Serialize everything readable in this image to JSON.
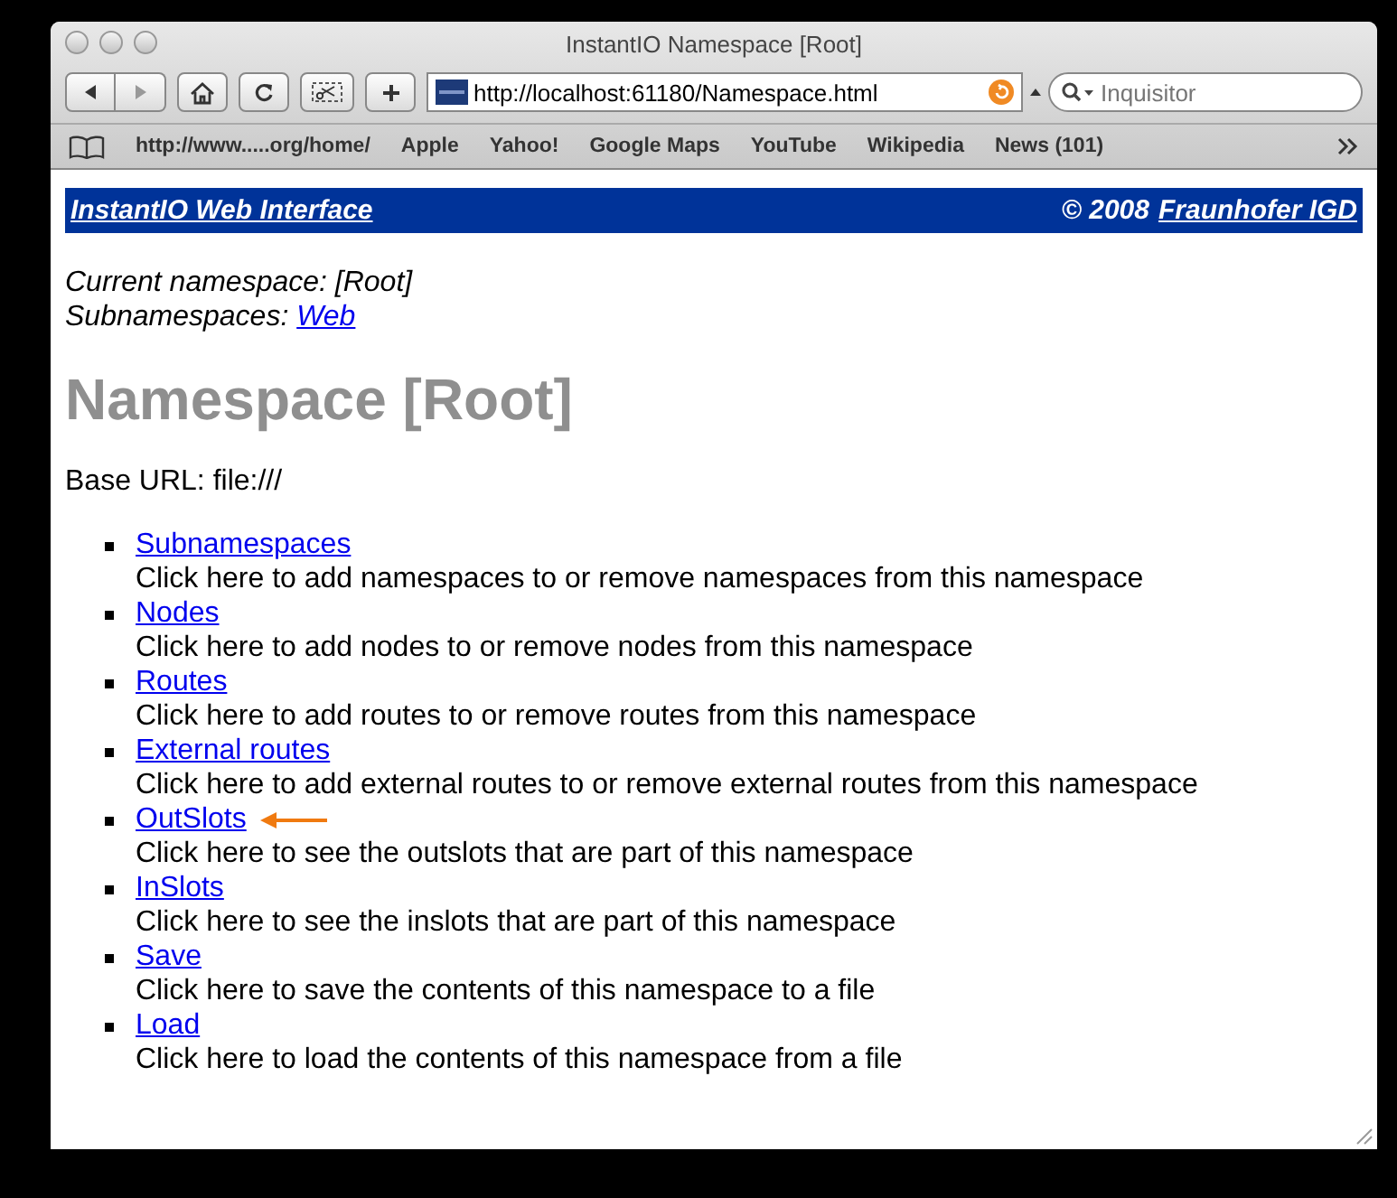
{
  "window": {
    "title": "InstantIO Namespace [Root]"
  },
  "toolbar": {
    "address": "http://localhost:61180/Namespace.html",
    "search_placeholder": "Inquisitor"
  },
  "bookmarks": [
    "http://www.....org/home/",
    "Apple",
    "Yahoo!",
    "Google Maps",
    "YouTube",
    "Wikipedia",
    "News (101)"
  ],
  "banner": {
    "title": "InstantIO Web Interface",
    "copyright": "© 2008",
    "owner": "Fraunhofer IGD"
  },
  "current": {
    "label": "Current namespace:",
    "value": "[Root]"
  },
  "subnamespaces": {
    "label": "Subnamespaces:",
    "link": "Web"
  },
  "heading": "Namespace [Root]",
  "base_url": "Base URL: file:///",
  "items": [
    {
      "link": "Subnamespaces",
      "description": "Click here to add namespaces to or remove namespaces from this namespace",
      "marked": false
    },
    {
      "link": "Nodes",
      "description": "Click here to add nodes to or remove nodes from this namespace",
      "marked": false
    },
    {
      "link": "Routes",
      "description": "Click here to add routes to or remove routes from this namespace",
      "marked": false
    },
    {
      "link": "External routes",
      "description": "Click here to add external routes to or remove external routes from this namespace",
      "marked": false
    },
    {
      "link": "OutSlots",
      "description": "Click here to see the outslots that are part of this namespace",
      "marked": true
    },
    {
      "link": "InSlots",
      "description": "Click here to see the inslots that are part of this namespace",
      "marked": false
    },
    {
      "link": "Save",
      "description": "Click here to save the contents of this namespace to a file",
      "marked": false
    },
    {
      "link": "Load",
      "description": "Click here to load the contents of this namespace from a file",
      "marked": false
    }
  ]
}
